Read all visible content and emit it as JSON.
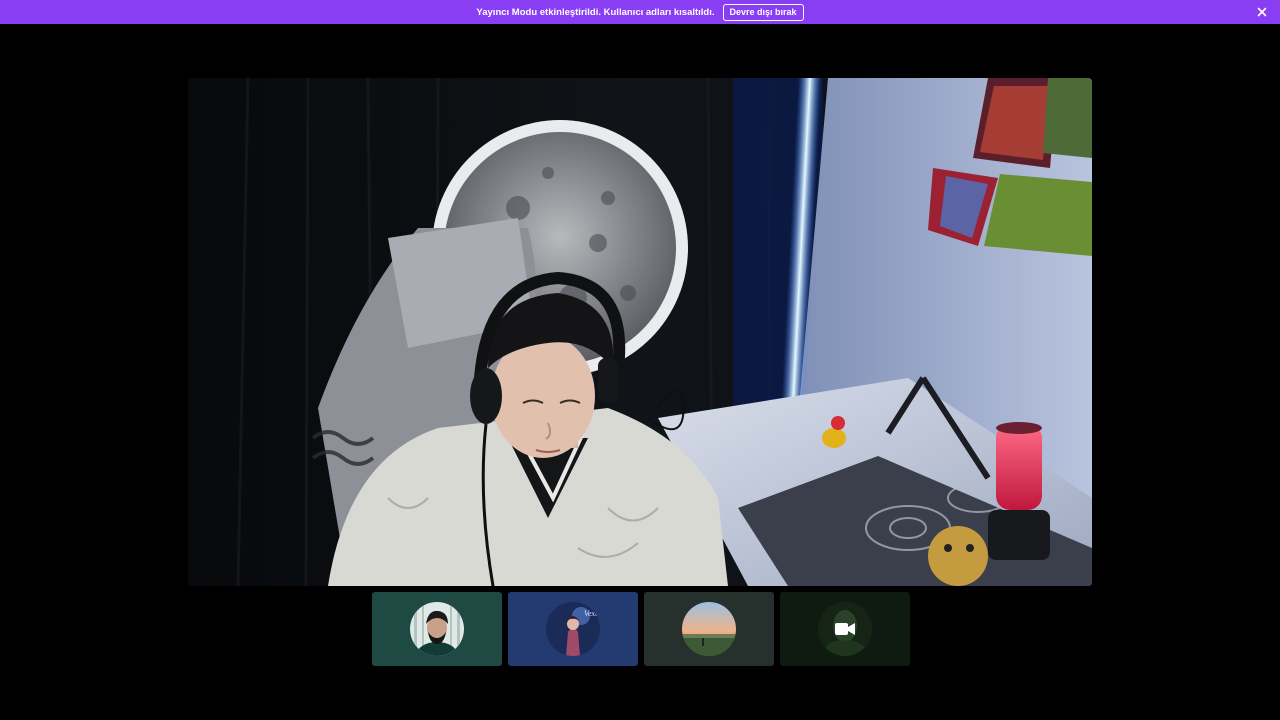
{
  "banner": {
    "message": "Yayıncı Modu etkinleştirildi. Kullanıcı adları kısaltıldı.",
    "disable_button": "Devre dışı bırak",
    "close_icon": "close-icon",
    "color": "#8a3ef3"
  },
  "stage": {
    "type": "participant-video"
  },
  "participants": [
    {
      "avatar": "bearded-man-avatar",
      "tile_color": "#1f4a44"
    },
    {
      "avatar": "vexan-character-avatar",
      "tile_color": "#233b70"
    },
    {
      "avatar": "sunset-landscape-avatar",
      "tile_color": "#26302d"
    },
    {
      "avatar": "camera-icon",
      "tile_color": "#0f1b10"
    }
  ]
}
